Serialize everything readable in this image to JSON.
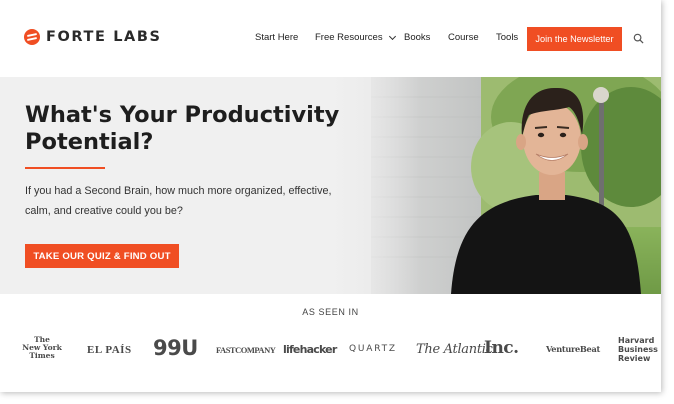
{
  "brand": {
    "name": "FORTE LABS",
    "accent": "#f04e23"
  },
  "nav": {
    "items": [
      "Start Here",
      "Free Resources",
      "Books",
      "Course",
      "Tools"
    ],
    "cta": "Join the Newsletter"
  },
  "icons": [
    "logo-mark",
    "chevron-down-icon",
    "search-icon"
  ],
  "hero": {
    "title": "What's Your Productivity Potential?",
    "subtitle": "If you had a Second Brain, how much more organized, effective, calm, and creative could you be?",
    "cta": "TAKE OUR QUIZ & FIND OUT"
  },
  "press": {
    "label": "AS SEEN IN",
    "nyt": [
      "The",
      "New York",
      "Times"
    ],
    "elpais": "EL PAÍS",
    "u99": "99U",
    "fastcompany": "FASTCOMPANY",
    "lifehacker": "lifehacker",
    "quartz": "QUARTZ",
    "atlantic": "The Atlantic",
    "inc": "Inc.",
    "venturebeat": "VentureBeat",
    "hbr": [
      "Harvard",
      "Business",
      "Review"
    ]
  }
}
